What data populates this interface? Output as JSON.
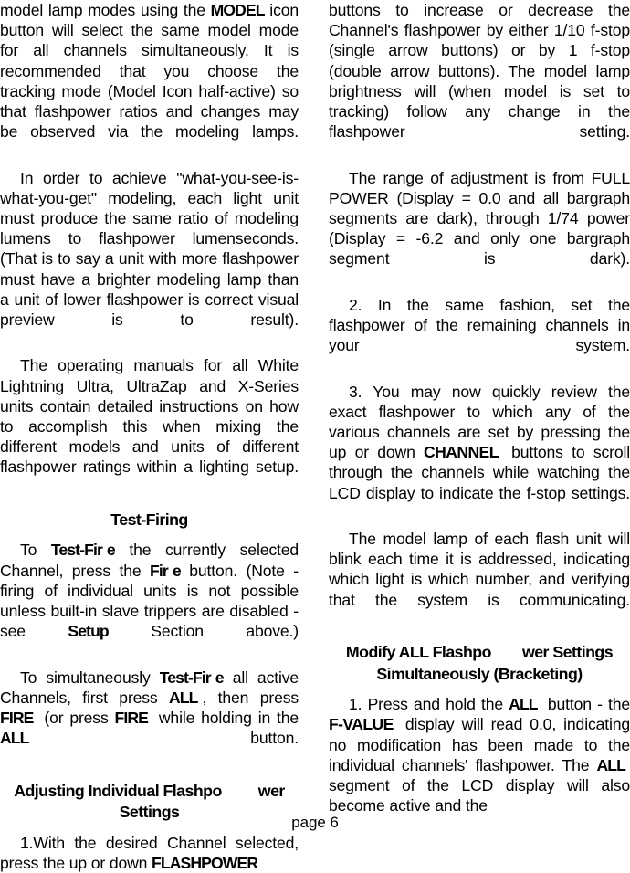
{
  "document": {
    "footer": "page 6",
    "page_number": "6"
  },
  "left_column": {
    "paragraphs": [
      {
        "id": "p1",
        "type": "continued",
        "text_before": "model lamp modes using the ",
        "emphasis": "MODEL",
        "text_after": " icon button will select the same model mode for all channels simultaneously. It is recommended that you choose the tracking mode (Model Icon half-active) so that flashpower ratios and changes may be observed via the modeling lamps.",
        "full_text": "model lamp modes using the MODEL icon button will select the same model mode for all channels simultaneously. It is recommended that you choose the tracking mode (Model Icon half-active) so that flashpower ratios and changes may be observed via the modeling lamps."
      },
      {
        "id": "p2",
        "type": "indented",
        "full_text": "In order to achieve \"what-you-see-is-what-you-get\" modeling, each light unit must produce the same ratio of modeling lumens to flashpower lumenseconds. (That is to say a unit with more flashpower must have a brighter modeling lamp than a unit of lower flashpower is correct visual preview is to result)."
      },
      {
        "id": "p3",
        "type": "indented",
        "full_text": "The operating manuals for all White Lightning Ultra, UltraZap and X-Series units contain detailed instructions on how to accomplish this when mixing the different models and units of different flashpower ratings within a lighting setup."
      }
    ],
    "heading_1": "Test-Firing",
    "paragraph_4": {
      "lead": "To ",
      "btn_1": "Test-Fir",
      "btn_1_tail": "e",
      "mid_1": " the currently selected Channel, press the ",
      "btn_2": "Fir",
      "btn_2_tail": "e",
      "mid_2": " button. (Note - firing of individual units is not possible unless built-in slave trippers are disabled -  see ",
      "btn_3": "Setup",
      "tail": " Section above.)",
      "full_text": "To Test-Fir e the currently selected Channel, press the Fir e button. (Note - firing of individual units is not possible unless built-in slave trippers are disabled -  see Setup  Section above.)"
    },
    "paragraph_5": {
      "lead": "To simultaneously ",
      "btn_1": "Test-Fir",
      "btn_1_tail": "e",
      "mid_1": " all active Channels, first press ",
      "btn_2": "ALL",
      "mid_2": ", then press ",
      "btn_3": "FIRE",
      "mid_3": " (or press ",
      "btn_4": "FIRE",
      "mid_4": " while holding in the ",
      "btn_5": "ALL",
      "tail": " button.",
      "full_text": "To simultaneously Test-Fir e all active Channels, first press ALL , then press FIRE  (or press FIRE  while holding in the ALL  button."
    },
    "heading_2_line1_a": "Adjusting Individual Flashpo",
    "heading_2_line1_b": "wer",
    "heading_2_line2": "Settings",
    "heading_2_full": "Adjusting Individual Flashpo wer Settings",
    "paragraph_6": {
      "lead": "1.With the desired Channel selected, press the up or down ",
      "btn_1": "FLASHPOWER",
      "full_text": "1.With the desired Channel selected, press the up or down FLASHPOWER"
    }
  },
  "right_column": {
    "paragraph_1": {
      "full_text": "buttons to increase or decrease the Channel's flashpower by either 1/10 f-stop (single arrow buttons) or by 1 f-stop (double arrow buttons). The model lamp brightness will (when model is set to tracking) follow any change in the flashpower setting."
    },
    "paragraph_2": {
      "full_text": "The range of adjustment is from FULL POWER (Display = 0.0 and all bargraph segments are dark), through 1/74 power (Display = -6.2  and only one bargraph segment is dark)."
    },
    "paragraph_3": {
      "full_text": "2. In the same fashion, set the flashpower of the remaining channels in your system."
    },
    "paragraph_4": {
      "lead": "3. You may now quickly review the exact flashpower to which any of the various channels are set by pressing the up or down ",
      "btn_1": "CHANNEL",
      "tail": " buttons to scroll through the channels while watching the LCD display to indicate the f-stop settings.",
      "full_text": "3. You may now quickly review the exact flashpower to which any of the various channels are set by pressing the up or down CHANNEL  buttons to scroll through the channels while watching the LCD display to indicate the f-stop settings."
    },
    "paragraph_5": {
      "full_text": "The model lamp of each flash unit will blink each time it is addressed, indicating which light is which number, and verifying that the system is communicating."
    },
    "heading_1_line1_a": "Modify ALL Flashpo",
    "heading_1_line1_b": "wer Settings",
    "heading_1_line2": "Simultaneously (Bracketing)",
    "heading_1_full": "Modify ALL Flashpo wer Settings Simultaneously (Bracketing)",
    "paragraph_6": {
      "lead": "1. Press and hold the ",
      "btn_1": "ALL",
      "mid_1": " button - the ",
      "btn_2": "F-VALUE",
      "mid_2": " display will read 0.0, indicating no modification has been made to the individual channels' flashpower. The ",
      "btn_3": "ALL",
      "tail": " segment of the LCD display will also become active and the",
      "full_text": "1. Press and hold the ALL  button - the F-VALUE  display will read 0.0, indicating no modification has been made to the individual channels' flashpower. The ALL  segment of the LCD display will also become active and the"
    }
  },
  "colors": {
    "background": "#ffffff",
    "text": "#000000"
  }
}
